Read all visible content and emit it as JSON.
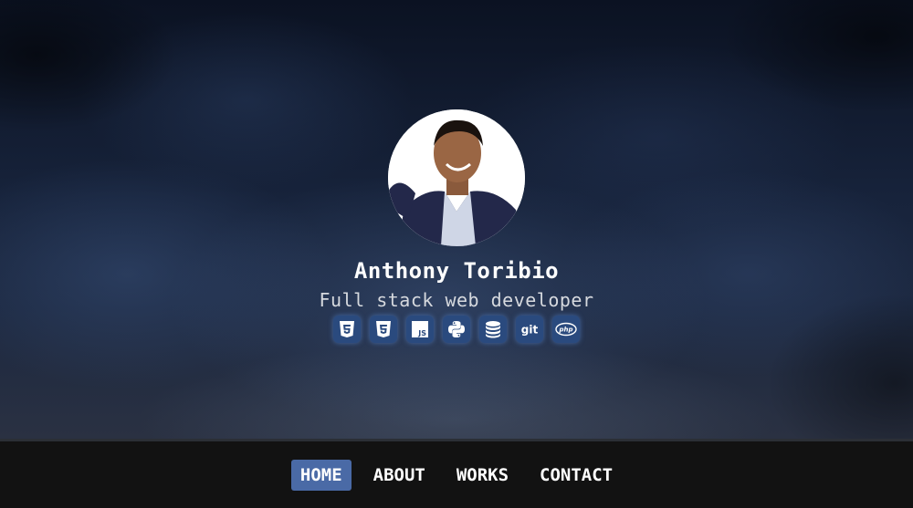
{
  "profile": {
    "name": "Anthony Toribio",
    "role": "Full stack web developer"
  },
  "skills": [
    {
      "icon": "html5-icon"
    },
    {
      "icon": "css3-icon"
    },
    {
      "icon": "javascript-icon",
      "label": "JS"
    },
    {
      "icon": "python-icon"
    },
    {
      "icon": "database-icon"
    },
    {
      "icon": "git-icon",
      "label": "git"
    },
    {
      "icon": "php-icon",
      "label": "php"
    }
  ],
  "nav": {
    "items": [
      {
        "label": "HOME",
        "active": true
      },
      {
        "label": "ABOUT",
        "active": false
      },
      {
        "label": "WORKS",
        "active": false
      },
      {
        "label": "CONTACT",
        "active": false
      }
    ]
  },
  "colors": {
    "accent": "#4a6aa6",
    "skill_badge": "#2a4a7e",
    "nav_background": "#121212"
  }
}
